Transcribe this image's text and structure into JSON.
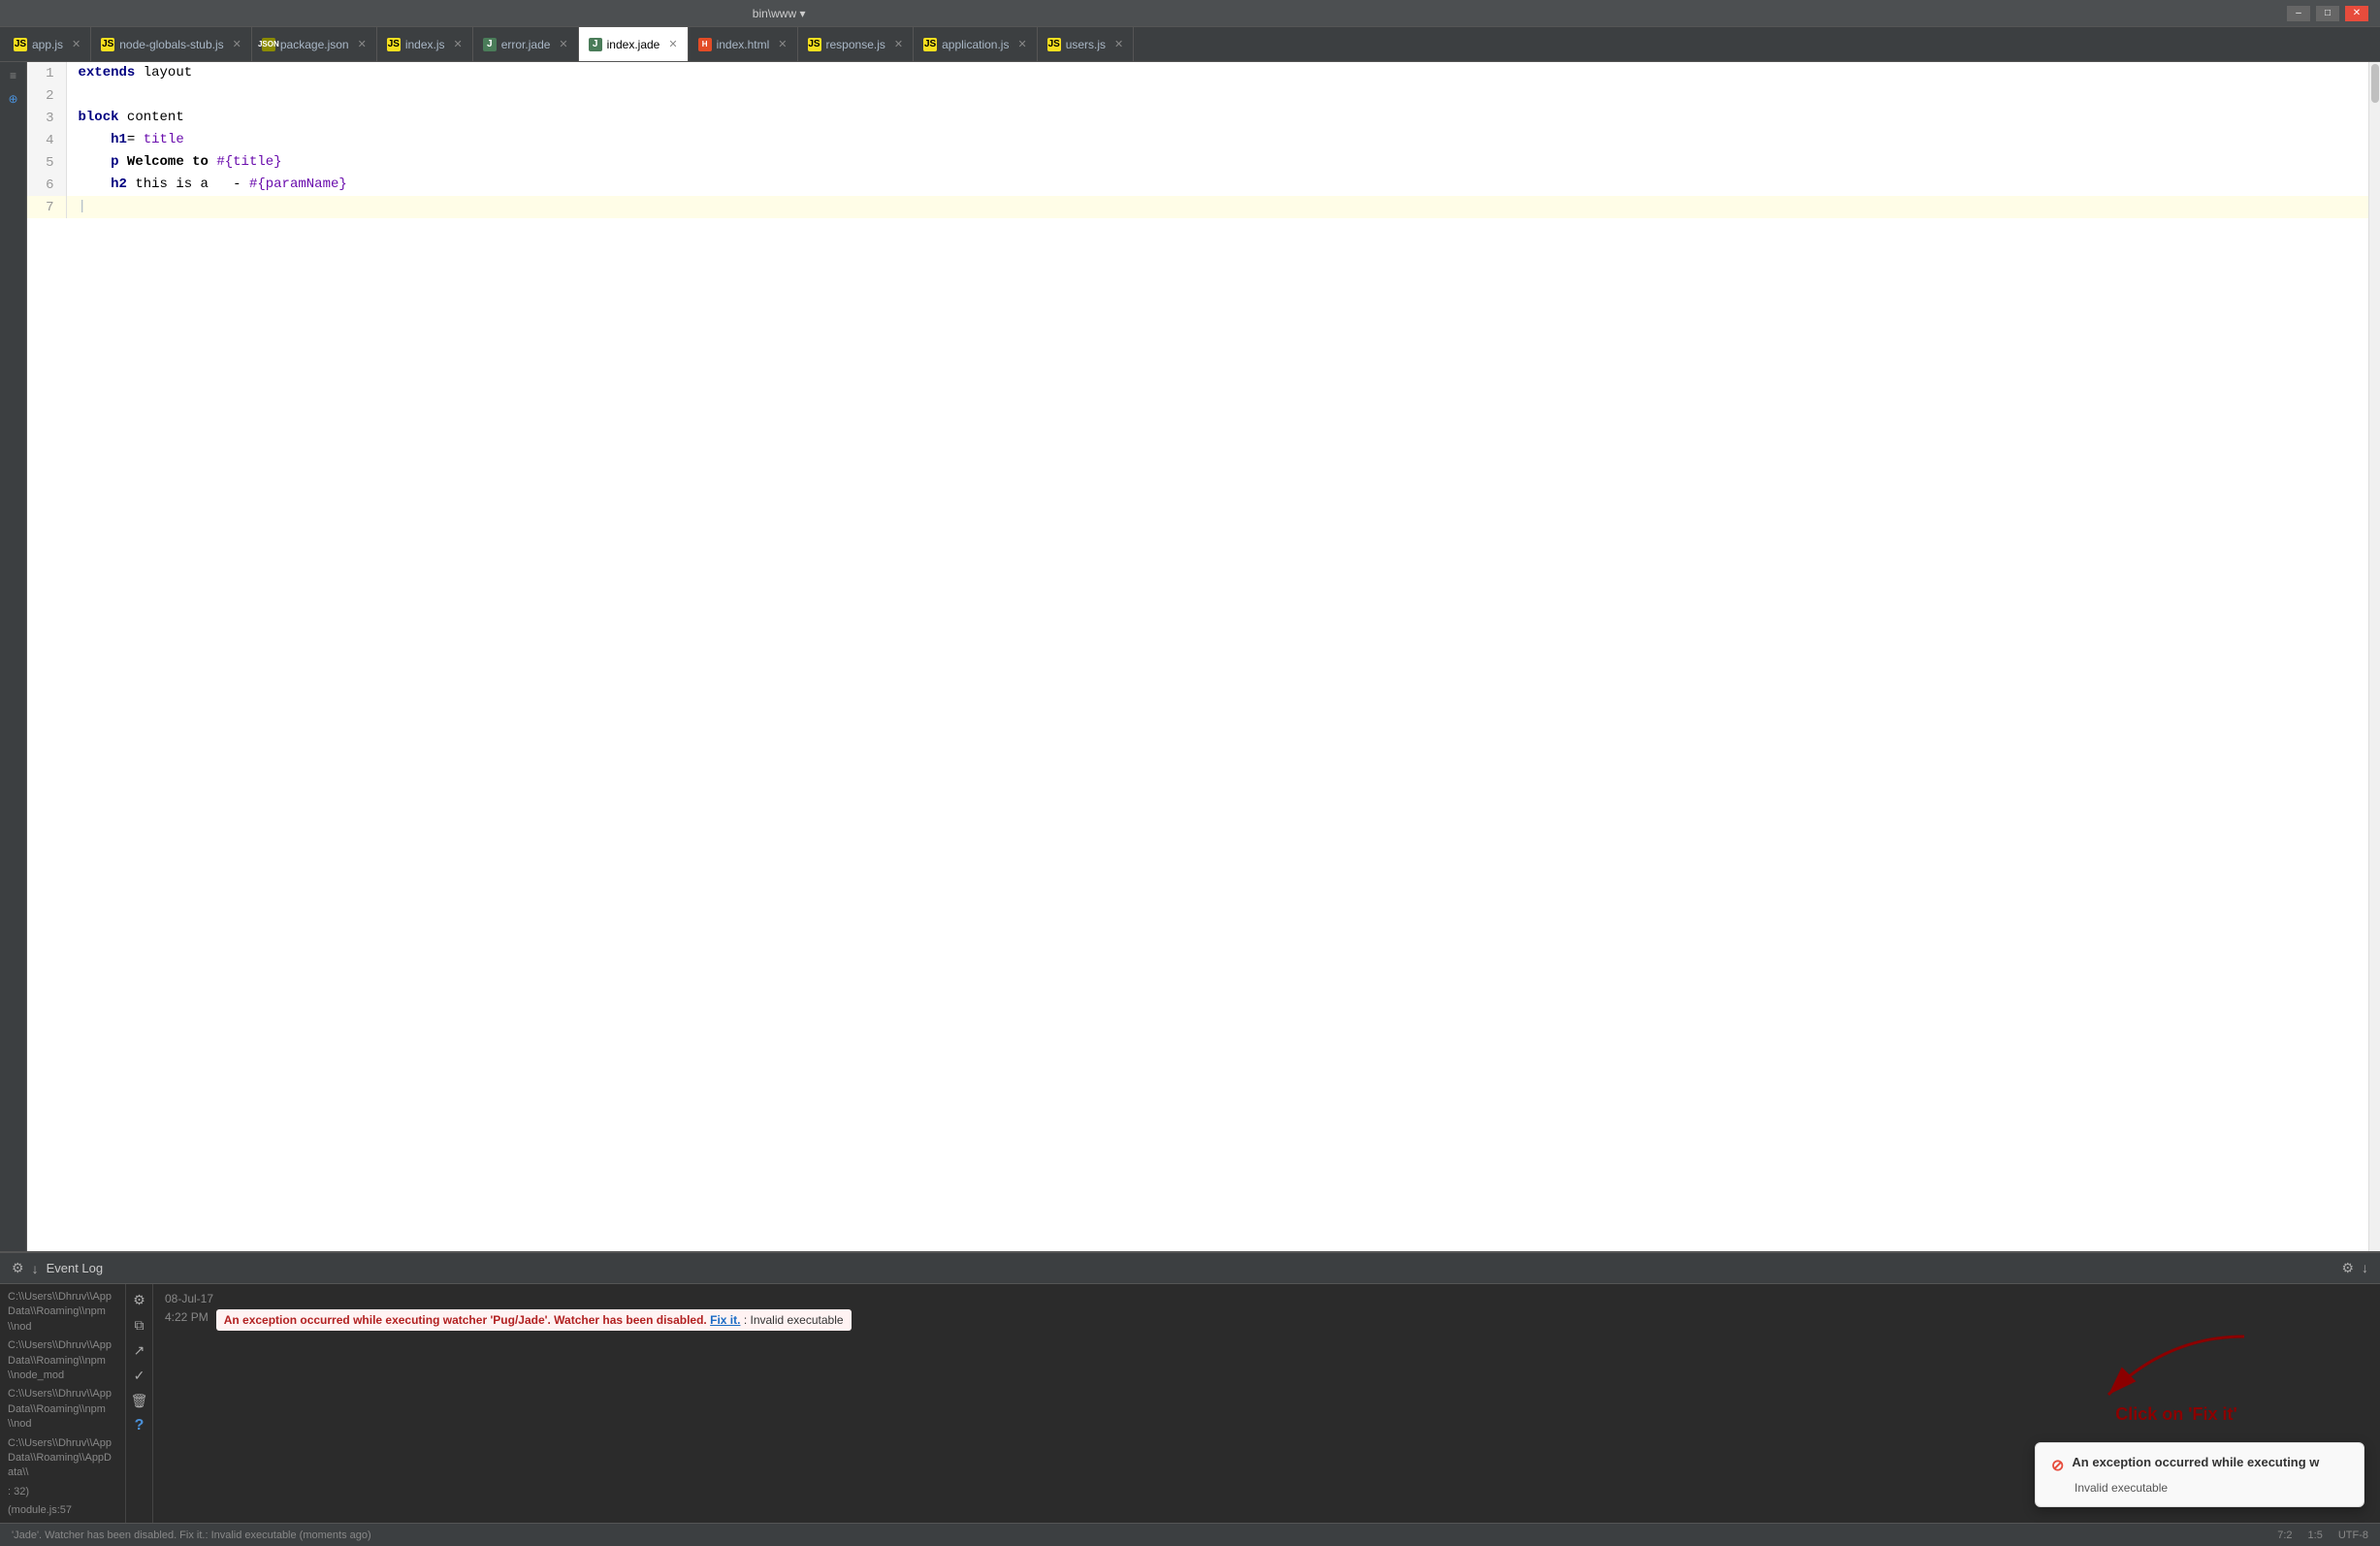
{
  "titleBar": {
    "path": "bin\\www ▾",
    "controls": [
      "–",
      "□",
      "✕"
    ]
  },
  "tabs": [
    {
      "id": "app-js",
      "label": "app.js",
      "type": "js",
      "active": false
    },
    {
      "id": "node-globals-stub-js",
      "label": "node-globals-stub.js",
      "type": "js",
      "active": false
    },
    {
      "id": "package-json",
      "label": "package.json",
      "type": "json",
      "active": false
    },
    {
      "id": "index-js",
      "label": "index.js",
      "type": "js",
      "active": false
    },
    {
      "id": "error-jade",
      "label": "error.jade",
      "type": "jade",
      "active": false
    },
    {
      "id": "index-jade",
      "label": "index.jade",
      "type": "jade",
      "active": true
    },
    {
      "id": "index-html",
      "label": "index.html",
      "type": "html",
      "active": false
    },
    {
      "id": "response-js",
      "label": "response.js",
      "type": "js",
      "active": false
    },
    {
      "id": "application-js",
      "label": "application.js",
      "type": "js",
      "active": false
    },
    {
      "id": "users-js",
      "label": "users.js",
      "type": "js",
      "active": false
    }
  ],
  "editor": {
    "lines": [
      {
        "num": 1,
        "content": "extends layout",
        "highlight": false
      },
      {
        "num": 2,
        "content": "",
        "highlight": false
      },
      {
        "num": 3,
        "content": "block content",
        "highlight": false
      },
      {
        "num": 4,
        "content": "    h1= title",
        "highlight": false
      },
      {
        "num": 5,
        "content": "    p Welcome to #{title}",
        "highlight": false
      },
      {
        "num": 6,
        "content": "    h2 this is a   - #{paramName}",
        "highlight": false
      },
      {
        "num": 7,
        "content": "",
        "highlight": true
      }
    ]
  },
  "bottomPanel": {
    "title": "Event Log",
    "gearLabel": "⚙",
    "downloadLabel": "↓",
    "sidebarItems": [
      "C:\\Users\\Dhruv\\AppData\\Roaming\\npm\\nod",
      "C:\\Users\\Dhruv\\AppData\\Roaming\\npm\\node_mod",
      "C:\\Users\\Dhruv\\AppData\\Roaming\\npm\\nod",
      "C:\\Users\\Dhruv\\AppData\\Roaming\\AppData\\",
      ": 32)",
      "(module.js:57"
    ],
    "actionIcons": [
      "⚙",
      "↓",
      "⧉",
      "↗",
      "✓",
      "🗑",
      "?"
    ],
    "logDate": "08-Jul-17",
    "logTime": "4:22 PM",
    "logMessageBold": "An exception occurred while executing watcher 'Pug/Jade'. Watcher has been disabled.",
    "logLinkText": "Fix it.",
    "logSuffix": ": Invalid executable",
    "annotationText": "Click on 'Fix it'",
    "notification": {
      "title": "An exception occurred while executing w",
      "subtitle": "Invalid executable"
    }
  },
  "statusBar": {
    "leftText": "'Jade'. Watcher has been disabled. Fix it.: Invalid executable (moments ago)",
    "lineCol": "7:2",
    "indent": "1:5",
    "encoding": "UTF-8"
  }
}
